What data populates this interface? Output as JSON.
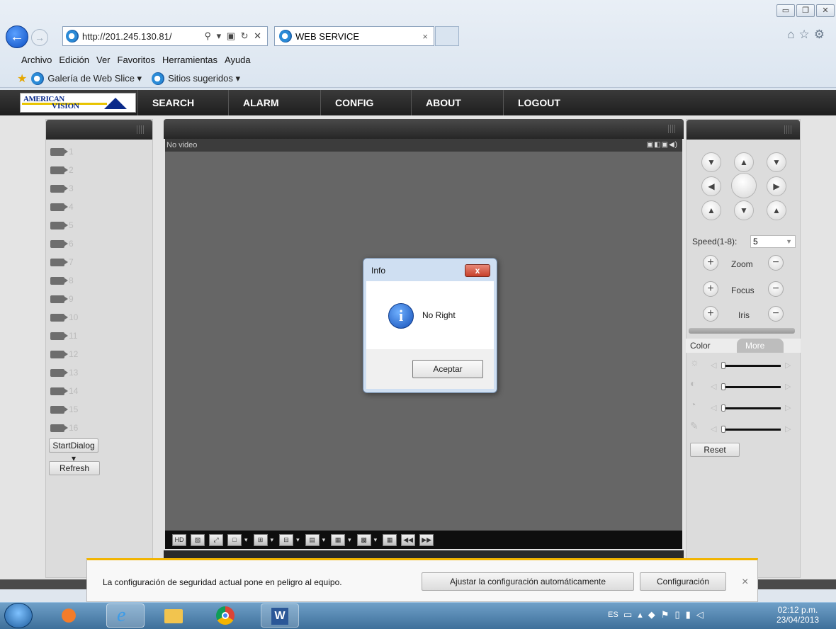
{
  "browser": {
    "address": "http://201.245.130.81/",
    "address_controls": "⚲ ▾ ▣ ↻ ✕",
    "tab_title": "WEB SERVICE",
    "tab_close": "×",
    "menu": [
      "Archivo",
      "Edición",
      "Ver",
      "Favoritos",
      "Herramientas",
      "Ayuda"
    ],
    "favorites": [
      "Galería de Web Slice ▾",
      "Sitios sugeridos ▾"
    ],
    "window_buttons": [
      "▭",
      "❐",
      "✕"
    ]
  },
  "app": {
    "nav": [
      "SEARCH",
      "ALARM",
      "CONFIG",
      "ABOUT",
      "LOGOUT"
    ],
    "channels": [
      "1",
      "2",
      "3",
      "4",
      "5",
      "6",
      "7",
      "8",
      "9",
      "10",
      "11",
      "12",
      "13",
      "14",
      "15",
      "16"
    ],
    "start_dialog": "StartDialog",
    "refresh": "Refresh",
    "video_status": "No video",
    "ptz": {
      "speed_label": "Speed(1-8):",
      "speed_value": "5",
      "zoom": "Zoom",
      "focus": "Focus",
      "iris": "Iris",
      "tab_color": "Color",
      "tab_more": "More",
      "reset": "Reset"
    }
  },
  "dialog": {
    "title": "Info",
    "close": "x",
    "message": "No Right",
    "ok": "Aceptar"
  },
  "notification": {
    "message": "La configuración de seguridad actual pone en peligro al equipo.",
    "fix_button": "Ajustar la configuración automáticamente",
    "settings_button": "Configuración",
    "close": "×"
  },
  "taskbar": {
    "lang": "ES",
    "time": "02:12 p.m.",
    "date": "23/04/2013"
  },
  "icons": [
    "back-icon",
    "forward-icon",
    "ie-icon",
    "home-icon",
    "star-icon",
    "gear-icon",
    "camera-icon",
    "info-icon",
    "windows-start-icon"
  ]
}
